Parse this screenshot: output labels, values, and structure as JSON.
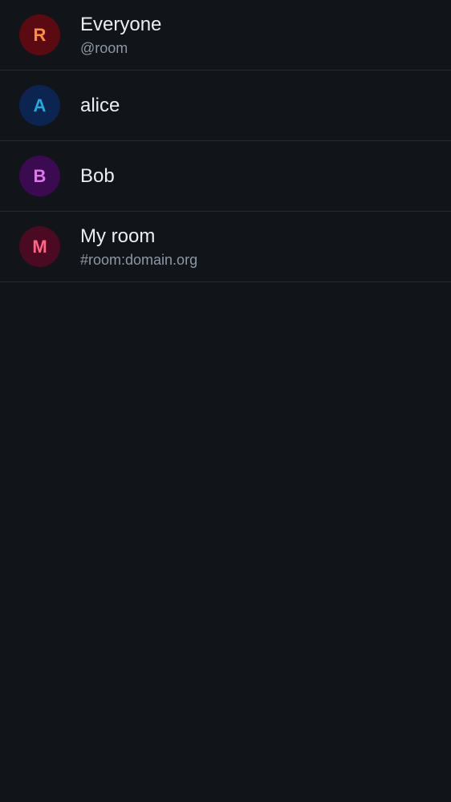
{
  "mentions": [
    {
      "initial": "R",
      "name": "Everyone",
      "subtitle": "@room",
      "avatar_bg": "#5b0a12",
      "avatar_fg": "#ff8c3c"
    },
    {
      "initial": "A",
      "name": "alice",
      "subtitle": "",
      "avatar_bg": "#0b2450",
      "avatar_fg": "#22aadd"
    },
    {
      "initial": "B",
      "name": "Bob",
      "subtitle": "",
      "avatar_bg": "#3c0a50",
      "avatar_fg": "#dd77ee"
    },
    {
      "initial": "M",
      "name": "My room",
      "subtitle": "#room:domain.org",
      "avatar_bg": "#4a0a22",
      "avatar_fg": "#ff6688"
    }
  ]
}
